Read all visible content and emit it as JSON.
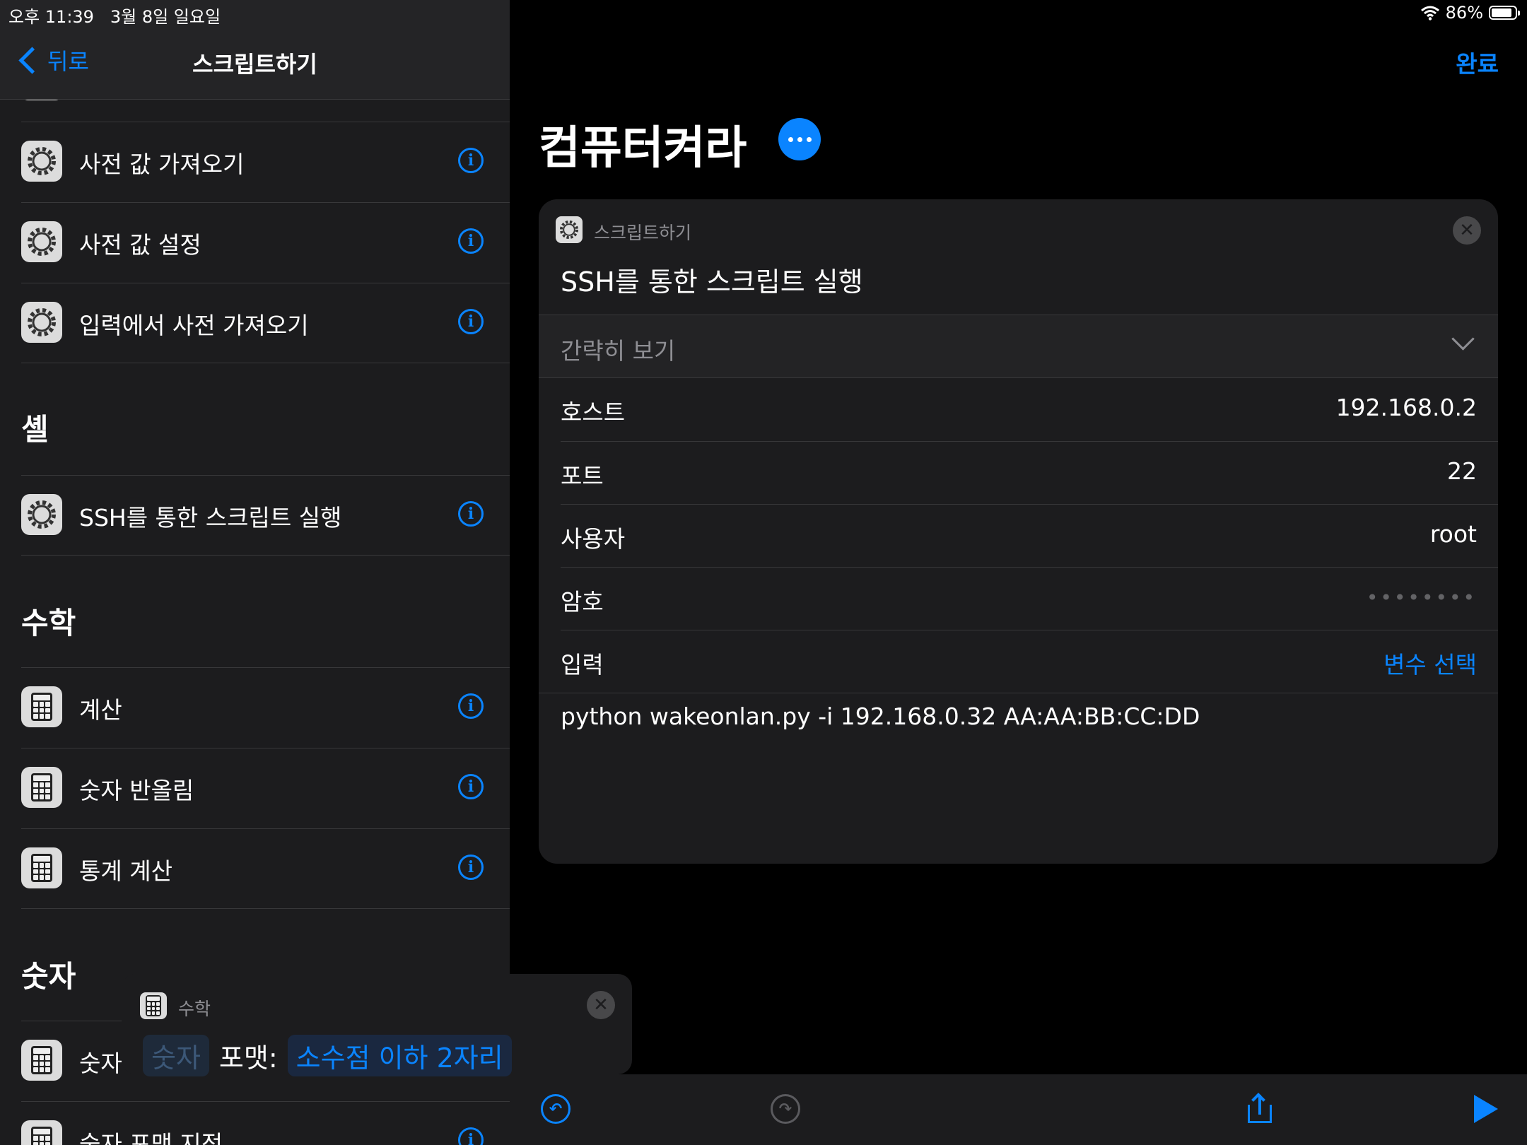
{
  "status_bar": {
    "time": "오후 11:39",
    "date": "3월 8일 일요일",
    "battery": "86%",
    "battery_level": 0.86
  },
  "left_nav": {
    "back_label": "뒤로",
    "title": "스크립트하기"
  },
  "left_list": {
    "dict_items": [
      {
        "label": "사전 값 가져오기",
        "icon": "gear-icon"
      },
      {
        "label": "사전 값 설정",
        "icon": "gear-icon"
      },
      {
        "label": "입력에서 사전 가져오기",
        "icon": "gear-icon"
      }
    ],
    "section_shell": "셸",
    "shell_items": [
      {
        "label": "SSH를 통한 스크립트 실행",
        "icon": "gear-icon"
      }
    ],
    "section_math": "수학",
    "math_items": [
      {
        "label": "계산",
        "icon": "calculator-icon"
      },
      {
        "label": "숫자 반올림",
        "icon": "calculator-icon"
      },
      {
        "label": "통계 계산",
        "icon": "calculator-icon"
      }
    ],
    "section_number": "숫자",
    "number_items": [
      {
        "label": "숫자",
        "icon": "calculator-icon"
      },
      {
        "label": "숫자 포맷 지정",
        "icon": "calculator-icon"
      }
    ]
  },
  "main": {
    "done_label": "완료",
    "shortcut_name": "컴퓨터켜라",
    "action_card": {
      "app_name": "스크립트하기",
      "action_title": "SSH를 통한 스크립트 실행",
      "collapse_label": "간략히 보기",
      "params": [
        {
          "label": "호스트",
          "value": "192.168.0.2"
        },
        {
          "label": "포트",
          "value": "22"
        },
        {
          "label": "사용자",
          "value": "root"
        },
        {
          "label": "암호",
          "value": "••••••••"
        },
        {
          "label": "입력",
          "value": "변수 선택"
        }
      ],
      "script": "python wakeonlan.py -i 192.168.0.32 AA:AA:BB:CC:DD"
    }
  },
  "drag_card": {
    "app_name": "수학",
    "token_number": "숫자",
    "format_label": "포맷:",
    "format_value": "소수점 이하 2자리"
  },
  "colors": {
    "accent": "#0a84ff",
    "panel": "#1c1c1e",
    "background": "#000000"
  }
}
